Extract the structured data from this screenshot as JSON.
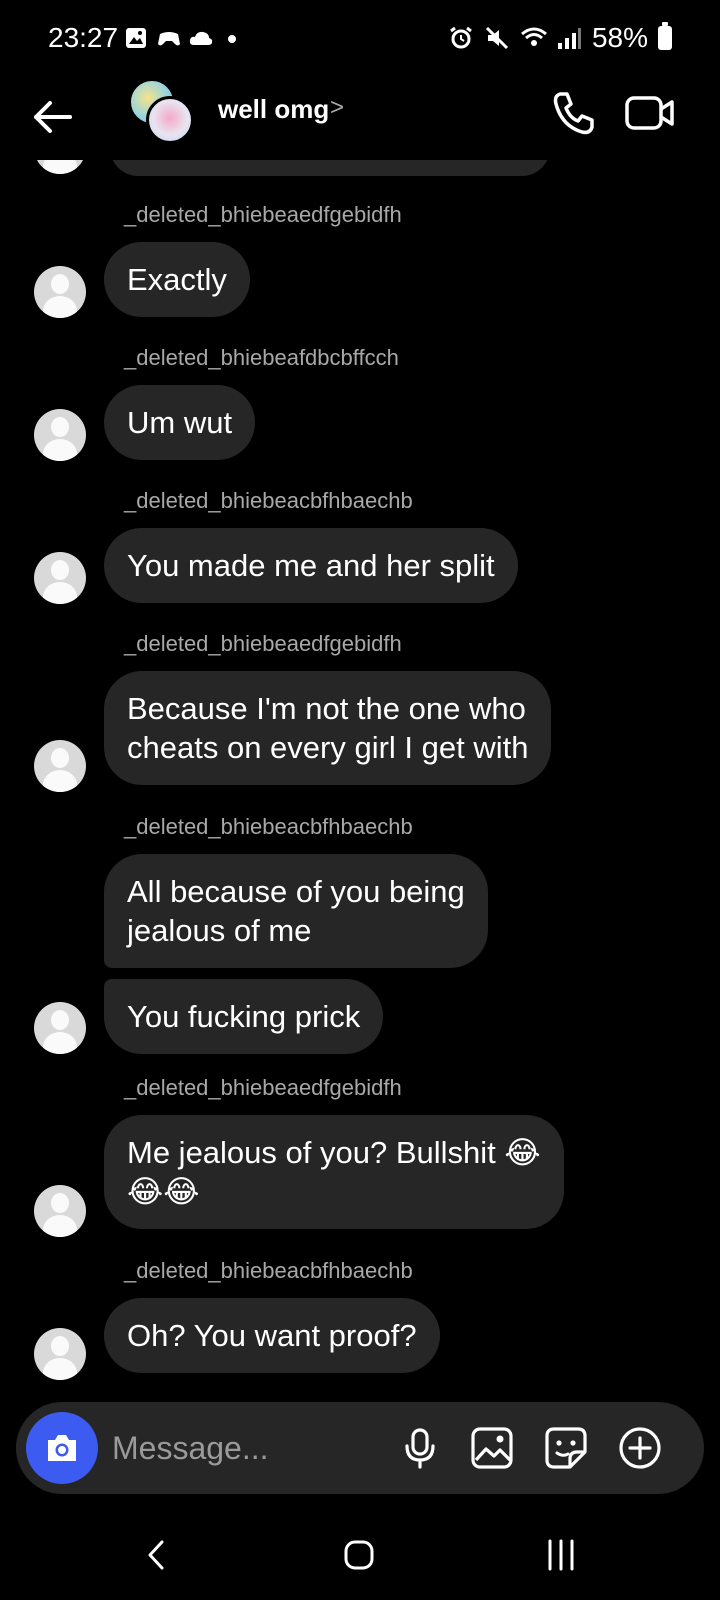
{
  "status_bar": {
    "time": "23:27",
    "battery_text": "58%",
    "left_icons": [
      "gallery-icon",
      "game-controller-icon",
      "cloud-icon",
      "dot-icon"
    ],
    "right_icons": [
      "alarm-icon",
      "mute-icon",
      "wifi-icon",
      "signal-icon",
      "battery-icon"
    ]
  },
  "header": {
    "title": "well omg",
    "chevron": ">",
    "icons": [
      "back-arrow-icon",
      "phone-icon",
      "video-camera-icon"
    ]
  },
  "messages": [
    {
      "sender": "_deleted_bhiebeaedfgebidfh",
      "bubbles": [
        "Exactly"
      ]
    },
    {
      "sender": "_deleted_bhiebeafdbcbffcch",
      "bubbles": [
        "Um wut"
      ]
    },
    {
      "sender": "_deleted_bhiebeacbfhbaechb",
      "bubbles": [
        "You made me and her split"
      ]
    },
    {
      "sender": "_deleted_bhiebeaedfgebidfh",
      "bubbles": [
        "Because I'm not the one who\ncheats on every girl I get with"
      ]
    },
    {
      "sender": "_deleted_bhiebeacbfhbaechb",
      "bubbles": [
        "All because of you being\njealous of me",
        "You fucking prick"
      ]
    },
    {
      "sender": "_deleted_bhiebeaedfgebidfh",
      "bubbles": [
        "Me jealous of you? Bullshit 😂\n😂😂"
      ]
    },
    {
      "sender": "_deleted_bhiebeacbfhbaechb",
      "bubbles": [
        "Oh? You want proof?"
      ]
    }
  ],
  "composer": {
    "placeholder": "Message...",
    "icons": [
      "camera-icon",
      "microphone-icon",
      "image-icon",
      "sticker-icon",
      "plus-icon"
    ]
  },
  "nav_bar": {
    "icons": [
      "nav-back-icon",
      "nav-home-icon",
      "nav-recents-icon"
    ]
  },
  "colors": {
    "background": "#000000",
    "bubble": "#262626",
    "sender_text": "#a8a8a8",
    "camera_button": "#3c5bf0",
    "placeholder": "#9a9a9a"
  }
}
